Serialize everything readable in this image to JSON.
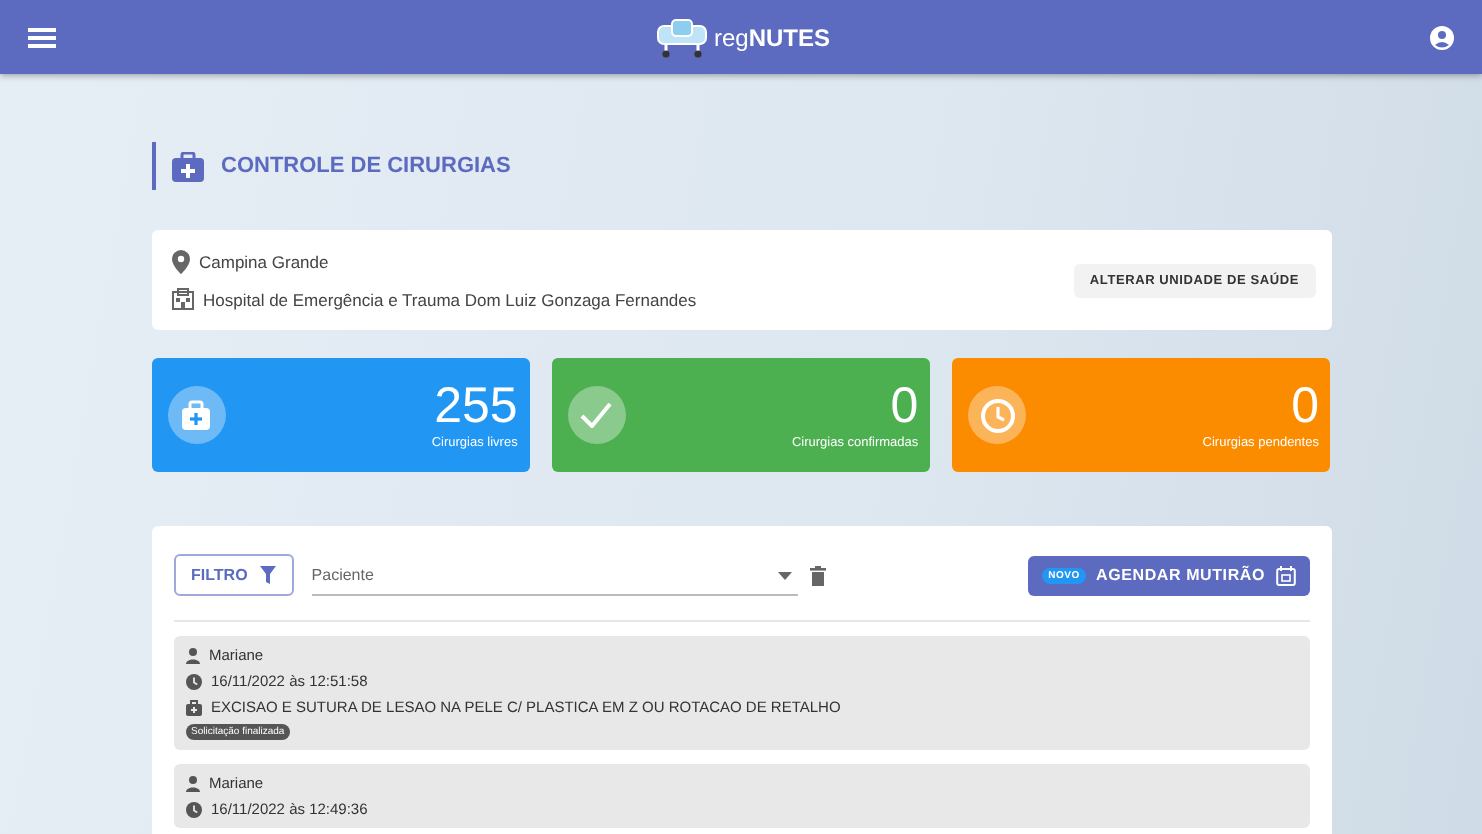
{
  "app_bar": {
    "logo_text_light": "reg",
    "logo_text_bold": "NUTES"
  },
  "page_title": "CONTROLE DE CIRURGIAS",
  "unit": {
    "city": "Campina Grande",
    "hospital": "Hospital de Emergência e Trauma Dom Luiz Gonzaga Fernandes",
    "change_button": "ALTERAR UNIDADE DE SAÚDE"
  },
  "stats": [
    {
      "kind": "free",
      "color": "#2196f3",
      "value": "255",
      "label": "Cirurgias livres"
    },
    {
      "kind": "confirmed",
      "color": "#4caf50",
      "value": "0",
      "label": "Cirurgias confirmadas"
    },
    {
      "kind": "pending",
      "color": "#fb8c00",
      "value": "0",
      "label": "Cirurgias pendentes"
    }
  ],
  "toolbar": {
    "filter_button": "FILTRO",
    "patient_select": {
      "placeholder": "Paciente"
    },
    "new_badge": "NOVO",
    "schedule_button": "AGENDAR MUTIRÃO"
  },
  "requests": [
    {
      "patient": "Mariane",
      "datetime": "16/11/2022 às 12:51:58",
      "procedure": "EXCISAO E SUTURA DE LESAO NA PELE C/ PLASTICA EM Z OU ROTACAO DE RETALHO",
      "status": "Solicitação finalizada"
    },
    {
      "patient": "Mariane",
      "datetime": "16/11/2022 às 12:49:36"
    }
  ]
}
